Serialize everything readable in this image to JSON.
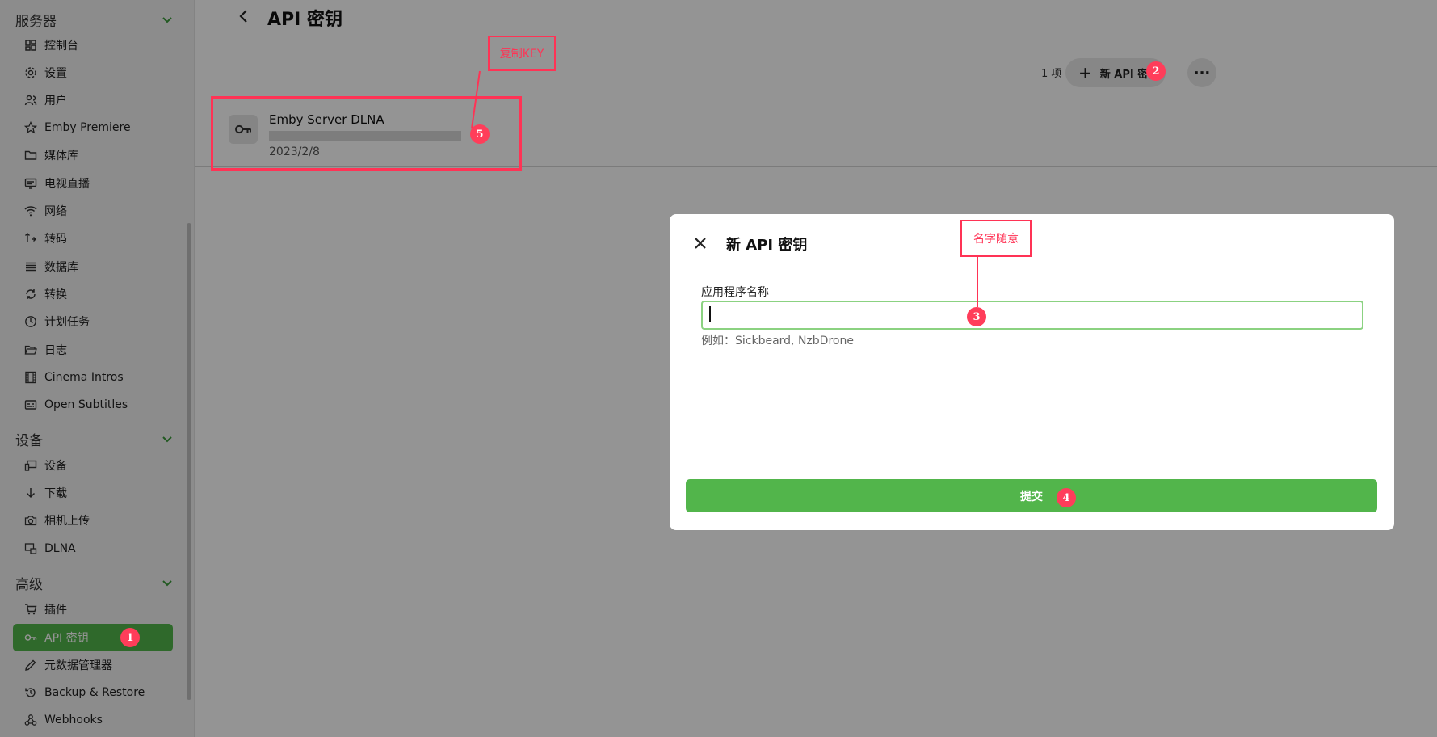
{
  "sidebar": {
    "sections": [
      {
        "title": "服务器"
      },
      {
        "title": "设备"
      },
      {
        "title": "高级"
      }
    ],
    "server_items": [
      {
        "label": "控制台",
        "icon": "dashboard-icon"
      },
      {
        "label": "设置",
        "icon": "gear-icon"
      },
      {
        "label": "用户",
        "icon": "users-icon"
      },
      {
        "label": "Emby Premiere",
        "icon": "star-icon"
      },
      {
        "label": "媒体库",
        "icon": "folder-icon"
      },
      {
        "label": "电视直播",
        "icon": "tv-guide-icon"
      },
      {
        "label": "网络",
        "icon": "wifi-icon"
      },
      {
        "label": "转码",
        "icon": "transcode-icon"
      },
      {
        "label": "数据库",
        "icon": "list-icon"
      },
      {
        "label": "转换",
        "icon": "convert-icon"
      },
      {
        "label": "计划任务",
        "icon": "clock-icon"
      },
      {
        "label": "日志",
        "icon": "folder-open-icon"
      },
      {
        "label": "Cinema Intros",
        "icon": "film-icon"
      },
      {
        "label": "Open Subtitles",
        "icon": "subtitles-icon"
      }
    ],
    "device_items": [
      {
        "label": "设备",
        "icon": "devices-icon"
      },
      {
        "label": "下载",
        "icon": "download-icon"
      },
      {
        "label": "相机上传",
        "icon": "camera-icon"
      },
      {
        "label": "DLNA",
        "icon": "dlna-icon"
      }
    ],
    "advanced_items": [
      {
        "label": "插件",
        "icon": "cart-icon"
      },
      {
        "label": "API 密钥",
        "icon": "key-icon"
      },
      {
        "label": "元数据管理器",
        "icon": "pencil-icon"
      },
      {
        "label": "Backup & Restore",
        "icon": "restore-icon"
      },
      {
        "label": "Webhooks",
        "icon": "webhooks-icon"
      }
    ]
  },
  "header": {
    "title": "API 密钥",
    "count": "1 项",
    "new_key_label": "新 API 密钥",
    "more_label": "···"
  },
  "keys": [
    {
      "name": "Emby Server DLNA",
      "date": "2023/2/8"
    }
  ],
  "dialog": {
    "title": "新 API 密钥",
    "field_label": "应用程序名称",
    "field_value": "",
    "field_hint": "例如：Sickbeard, NzbDrone",
    "submit_label": "提交"
  },
  "annotations": {
    "copy_key": "复制KEY",
    "any_name": "名字随意",
    "steps": [
      "1",
      "2",
      "3",
      "4",
      "5"
    ]
  },
  "colors": {
    "accent": "#52b54b",
    "annotation": "#ff3355",
    "input_focus": "#8bd281"
  }
}
